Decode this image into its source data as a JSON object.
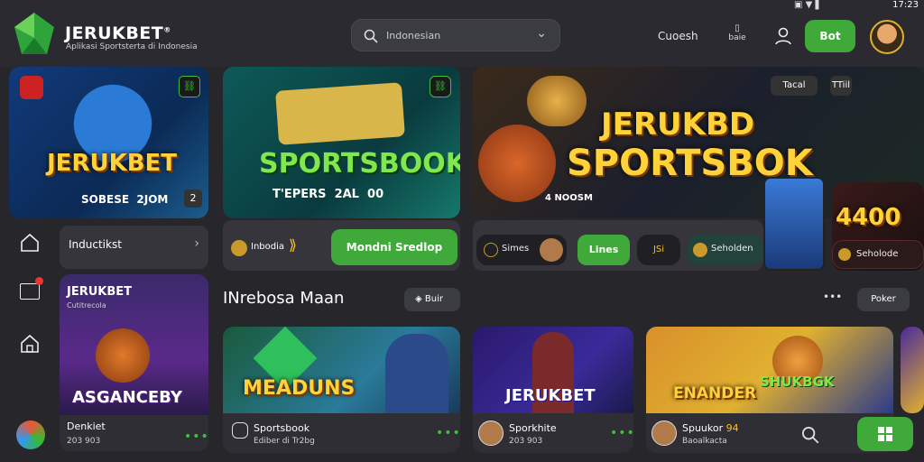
{
  "status_bar": {
    "time": "17:23"
  },
  "header": {
    "brand": "JERUKBET",
    "registered": "®",
    "tagline": "Aplikasi Sportsterta di Indonesia",
    "search_value": "Indonesian",
    "nav_label": "Cuoesh",
    "nav_icon2_label": "baie",
    "cta_button": "Bot"
  },
  "sidebar": {
    "menu_label": "Inductikst"
  },
  "banners": {
    "b1": {
      "title": "JERUKBET",
      "sub": "SOBESE",
      "sub2": "2JOM",
      "badge": "2"
    },
    "b2": {
      "title": "SPORTSBOOK",
      "sub": "T'EPERS",
      "sub2": "2AL",
      "sub3": "00"
    },
    "b3": {
      "title1": "JERUKBD",
      "title2": "SPORTSBOK",
      "sub": "4 NOOSM",
      "chip1": "Tacal",
      "chip2": "TTiil"
    },
    "b4": {
      "title": "4400"
    }
  },
  "row2": {
    "left_chip_text": "Inbodia",
    "mid_button": "Mondni Sredlop",
    "chip_a": "Simes",
    "chip_b": "Lines",
    "chip_c": "JSi",
    "chip_d": "Seholden",
    "chip_e": "Seholode"
  },
  "section": {
    "title": "INrebosa Maan",
    "filter_btn": "Buir",
    "more": "•••",
    "pill": "Poker"
  },
  "side_card": {
    "title": "JERUKBET",
    "sub": "Cutitrecola",
    "art_title": "ASGANCEBY",
    "name": "Denkiet",
    "meta": "203 903",
    "dots": "•••"
  },
  "games": [
    {
      "art": "MEADUNS",
      "name": "Sportsbook",
      "meta": "Ediber di Tr2bg",
      "dots": "•••"
    },
    {
      "art": "JERUKBET",
      "name": "Sporkhite",
      "meta": "203 903",
      "dots": "•••"
    },
    {
      "art1": "ENANDER",
      "art2": "SHUKBGK",
      "name": "Spuukor",
      "meta": "Baoalkacta",
      "badge": "94"
    }
  ],
  "colors": {
    "accent": "#3faa3a",
    "gold": "#ffd23a",
    "bg": "#26262b"
  }
}
